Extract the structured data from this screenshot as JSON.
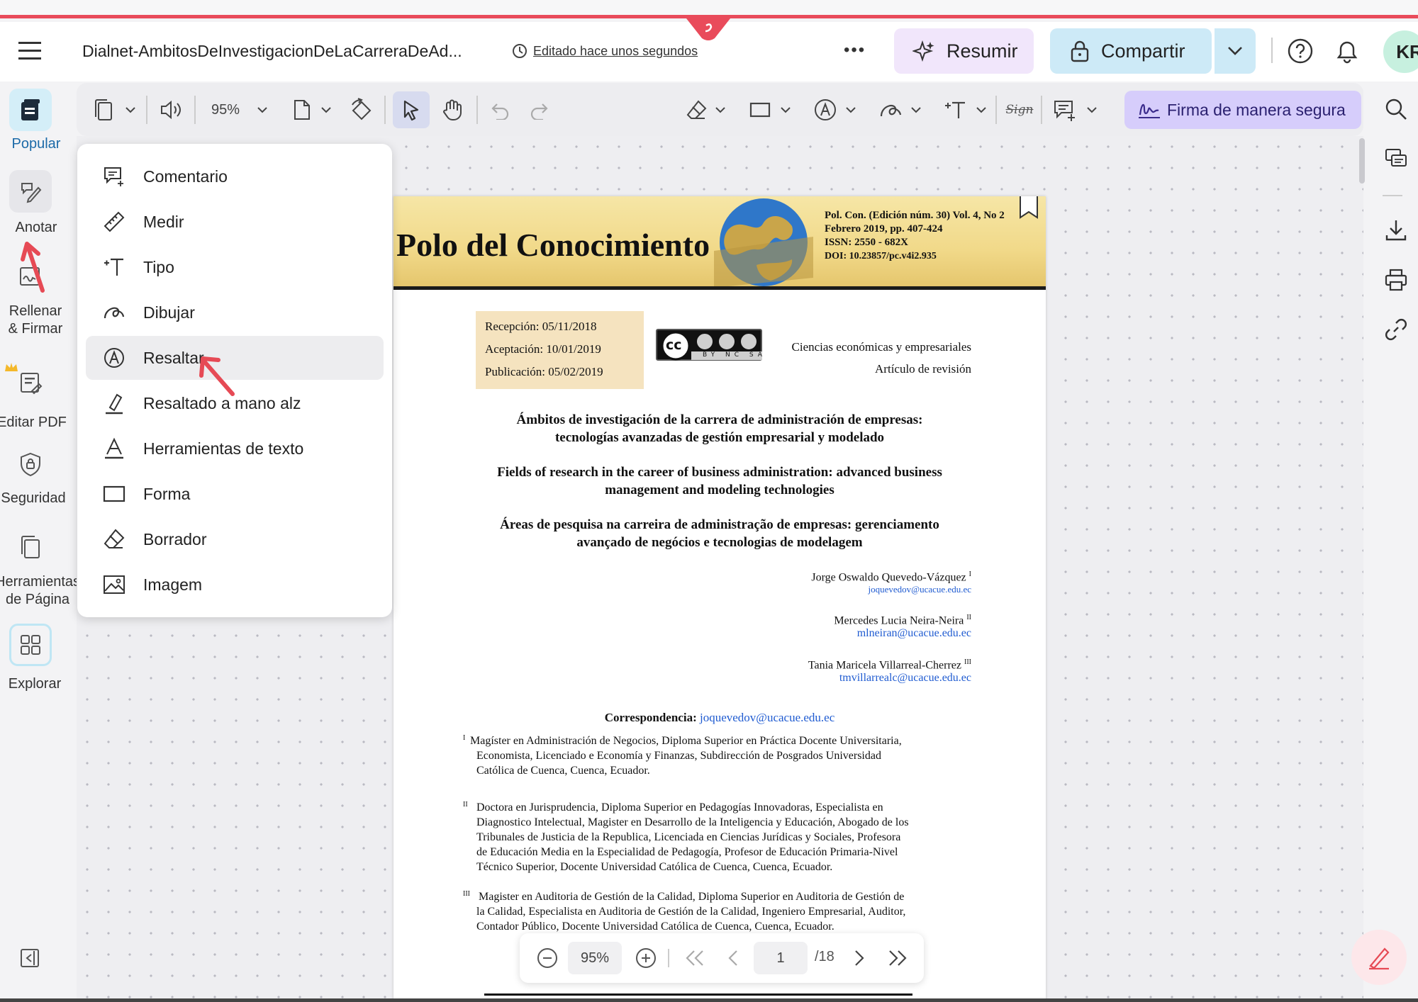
{
  "header": {
    "document_title": "Dialnet-AmbitosDeInvestigacionDeLaCarreraDeAd...",
    "edit_status": "Editado hace unos segundos",
    "more_label": "•••",
    "summarize_label": "Resumir",
    "share_label": "Compartir",
    "avatar_initials": "KR"
  },
  "left_rail": {
    "items": [
      {
        "label": "Popular"
      },
      {
        "label": "Anotar"
      },
      {
        "label": "Rellenar & Firmar"
      },
      {
        "label": "Editar PDF"
      },
      {
        "label": "Seguridad"
      },
      {
        "label": "Herramientas de Página"
      },
      {
        "label": "Explorar"
      }
    ]
  },
  "toolbar": {
    "zoom_value": "95%",
    "sign_label": "Sign",
    "secure_sign_label": "Firma de manera segura"
  },
  "annotate_menu": {
    "items": [
      {
        "label": "Comentario",
        "icon": "comment-icon"
      },
      {
        "label": "Medir",
        "icon": "ruler-icon"
      },
      {
        "label": "Tipo",
        "icon": "text-type-icon"
      },
      {
        "label": "Dibujar",
        "icon": "draw-icon"
      },
      {
        "label": "Resaltar",
        "icon": "highlight-icon",
        "active": true
      },
      {
        "label": "Resaltado a mano alz",
        "icon": "freehand-highlight-icon"
      },
      {
        "label": "Herramientas de texto",
        "icon": "text-tools-icon"
      },
      {
        "label": "Forma",
        "icon": "shape-icon"
      },
      {
        "label": "Borrador",
        "icon": "eraser-icon"
      },
      {
        "label": "Imagem",
        "icon": "image-icon"
      }
    ]
  },
  "pdf": {
    "journal_title": "Polo del Conocimiento",
    "journal_info": [
      "Pol. Con. (Edición núm. 30) Vol. 4, No 2",
      "Febrero 2019, pp. 407-424",
      "ISSN: 2550 - 682X",
      "DOI: 10.23857/pc.v4i2.935"
    ],
    "dates": [
      "Recepción: 05/11/2018",
      "Aceptación: 10/01/2019",
      "Publicación: 05/02/2019"
    ],
    "cc_badge": "BY NC SA",
    "category": "Ciencias económicas y empresariales",
    "article_type": "Artículo de revisión",
    "title_es": [
      "Ámbitos de investigación de la carrera de administración de empresas:",
      "tecnologías avanzadas de gestión empresarial y modelado"
    ],
    "title_en": [
      "Fields of research in the career of business administration: advanced business",
      "management and modeling technologies"
    ],
    "title_pt": [
      "Áreas de pesquisa na carreira de administração de empresas: gerenciamento",
      "avançado de negócios e tecnologias de modelagem"
    ],
    "authors": [
      {
        "name": "Jorge Oswaldo Quevedo-Vázquez",
        "sup": "I",
        "email": "joquevedov@ucacue.edu.ec"
      },
      {
        "name": "Mercedes Lucia Neira-Neira",
        "sup": "II",
        "email": "mlneiran@ucacue.edu.ec"
      },
      {
        "name": "Tania Maricela Villarreal-Cherrez",
        "sup": "III",
        "email": "tmvillarrealc@ucacue.edu.ec"
      }
    ],
    "correspondence_label": "Correspondencia:",
    "correspondence_email": "joquevedov@ucacue.edu.ec",
    "affiliations": [
      {
        "sup": "I",
        "lines": [
          "Magíster en Administración de Negocios, Diploma Superior en Práctica Docente Universitaria,",
          "Economista, Licenciado e Economía y Finanzas, Subdirección de Posgrados Universidad",
          "Católica de Cuenca, Cuenca, Ecuador."
        ]
      },
      {
        "sup": "II",
        "lines": [
          "Doctora en Jurisprudencia, Diploma Superior en Pedagogías Innovadoras, Especialista en",
          "Diagnostico Intelectual, Magister en Desarrollo de la Inteligencia y Educación, Abogado de los",
          "Tribunales de Justicia de la Republica, Licenciada en Ciencias Jurídicas y Sociales, Profesora",
          "de Educación Media en la Especialidad de Pedagogía, Profesor de Educación Primaria-Nivel",
          "Técnico Superior, Docente Universidad Católica de Cuenca, Cuenca, Ecuador."
        ]
      },
      {
        "sup": "III",
        "lines": [
          "Magister en Auditoria de Gestión de la Calidad, Diploma Superior en Auditoria de Gestión de",
          "la Calidad, Especialista en Auditoria de Gestión de la Calidad, Ingeniero Empresarial, Auditor,",
          "Contador Público, Docente Universidad Católica de Cuenca, Cuenca, Ecuador."
        ]
      }
    ]
  },
  "pager": {
    "zoom": "95%",
    "current_page": "1",
    "total_pages": "/18"
  },
  "colors": {
    "accent_red": "#e94b5b",
    "summarize_bg": "#f1e6fb",
    "share_bg": "#cdeaf7",
    "secure_sign_bg": "#d6cdfb",
    "avatar_bg": "#c7f0df",
    "annotation_arrow": "#e64a55"
  }
}
